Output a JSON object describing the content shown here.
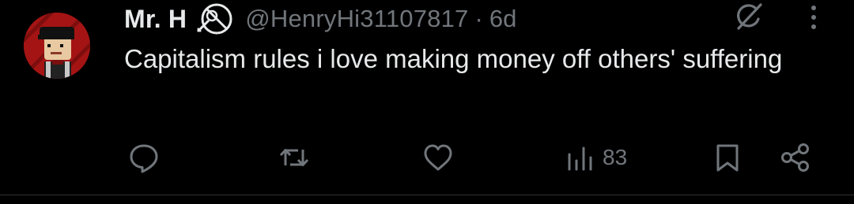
{
  "tweet": {
    "author": {
      "display_name": "Mr. H",
      "handle": "@HenryHi31107817"
    },
    "separator": "·",
    "time_ago": "6d",
    "text": "Capitalism rules i love making money off others' suffering",
    "views": "83"
  },
  "icons": {
    "badge": "crossed-out-circle-icon",
    "grok": "grok-slash-icon",
    "more": "more-vertical-icon",
    "reply": "reply-icon",
    "retweet": "retweet-icon",
    "like": "heart-icon",
    "views": "views-bar-chart-icon",
    "bookmark": "bookmark-icon",
    "share": "share-icon"
  },
  "colors": {
    "background": "#000000",
    "text_primary": "#e7e9ea",
    "text_secondary": "#71767b",
    "divider": "#2f3336",
    "avatar_background": "#a51414"
  }
}
